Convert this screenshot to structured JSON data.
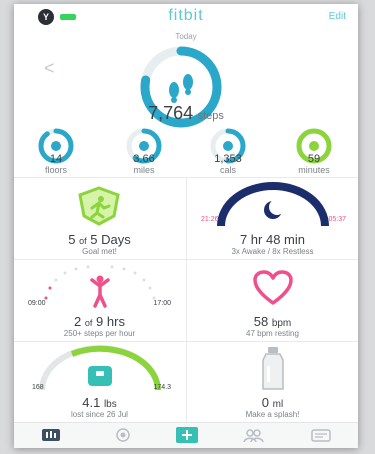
{
  "header": {
    "avatar_initial": "Y",
    "brand": "fitbit",
    "edit_label": "Edit",
    "day_label": "Today",
    "back_glyph": "<"
  },
  "steps": {
    "value": "7,764",
    "unit": "steps",
    "progress": 0.78
  },
  "stats": [
    {
      "value": "14",
      "label": "floors",
      "progress": 0.9,
      "color": "#2aa7c9",
      "icon": "stairs-icon"
    },
    {
      "value": "3.66",
      "label": "miles",
      "progress": 0.6,
      "color": "#2aa7c9",
      "icon": "location-pin-icon"
    },
    {
      "value": "1,353",
      "label": "cals",
      "progress": 0.5,
      "color": "#2aa7c9",
      "icon": "flame-icon"
    },
    {
      "value": "59",
      "label": "minutes",
      "progress": 1.0,
      "color": "#8bd43b",
      "icon": "lightning-icon"
    }
  ],
  "tiles": {
    "exercise": {
      "value": "5",
      "of": "of",
      "total": "5 Days",
      "sub": "Goal met!"
    },
    "sleep": {
      "duration": "7 hr 48 min",
      "sub": "3x Awake / 8x Restless",
      "start": "21:26",
      "end": "05:37"
    },
    "hourly": {
      "value": "2",
      "of": "of",
      "total": "9 hrs",
      "sub": "250+ steps per hour",
      "start": "09:00",
      "end": "17:00"
    },
    "heart": {
      "value": "58",
      "unit": "bpm",
      "sub": "47 bpm resting"
    },
    "weight": {
      "value": "4.1",
      "unit": "lbs",
      "sub": "lost since 26 Jul",
      "left": "168",
      "right": "174.3"
    },
    "water": {
      "value": "0",
      "unit": "ml",
      "sub": "Make a splash!"
    }
  },
  "tabs": [
    {
      "name": "dashboard-tab",
      "icon": "dashboard-icon"
    },
    {
      "name": "challenges-tab",
      "icon": "badge-icon"
    },
    {
      "name": "log-tab",
      "icon": "plus-icon"
    },
    {
      "name": "friends-tab",
      "icon": "friends-icon"
    },
    {
      "name": "messages-tab",
      "icon": "message-icon"
    }
  ],
  "colors": {
    "accent": "#2aa7c9",
    "green": "#8bd43b",
    "pink": "#f04f8b",
    "navy": "#1c2d6b",
    "text": "#3a3f44"
  }
}
